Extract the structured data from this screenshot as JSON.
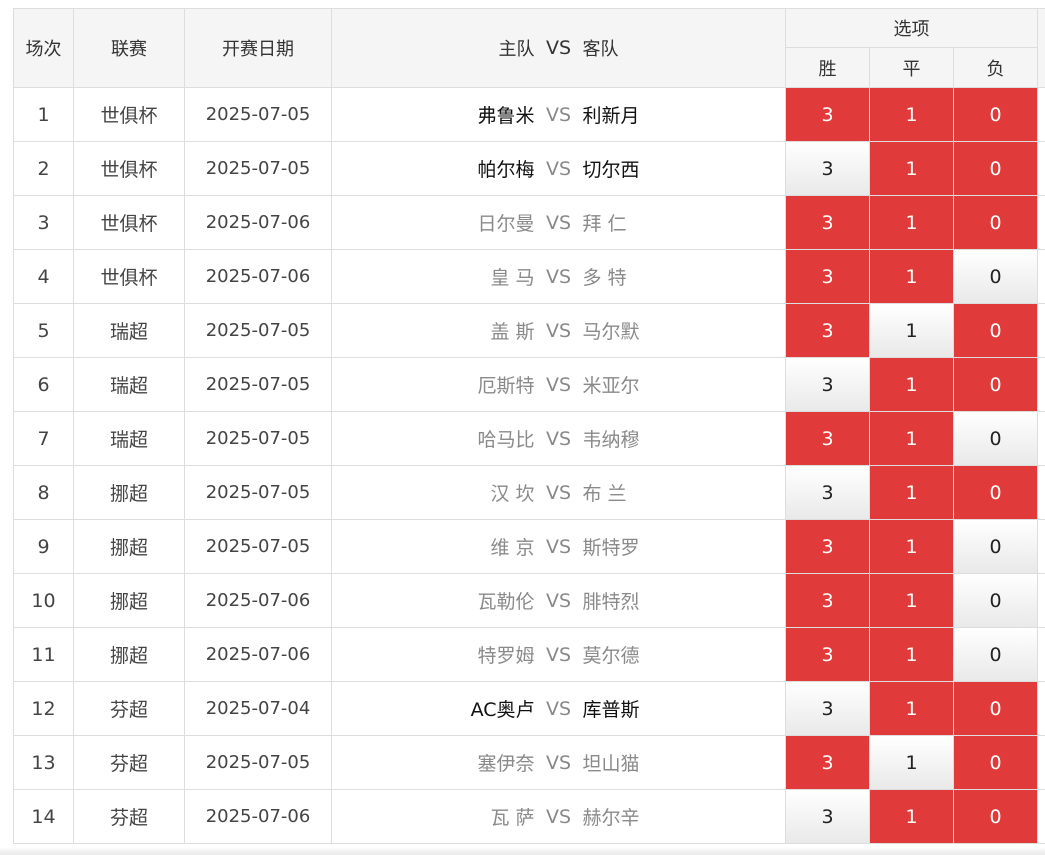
{
  "header": {
    "col_round": "场次",
    "col_league": "联赛",
    "col_date": "开赛日期",
    "col_home": "主队",
    "col_vs": "VS",
    "col_away": "客队",
    "col_options": "选项",
    "opt_win": "胜",
    "opt_draw": "平",
    "opt_loss": "负"
  },
  "colors": {
    "selected": "#e03a3a",
    "header_bg": "#f5f5f5",
    "border": "#dddddd"
  },
  "matches": [
    {
      "round": "1",
      "league": "世俱杯",
      "date": "2025-07-05",
      "home": "弗鲁米",
      "vs": "VS",
      "away": "利新月",
      "dark": true,
      "win": "3",
      "draw": "1",
      "loss": "0",
      "sel": [
        true,
        true,
        true
      ]
    },
    {
      "round": "2",
      "league": "世俱杯",
      "date": "2025-07-05",
      "home": "帕尔梅",
      "vs": "VS",
      "away": "切尔西",
      "dark": true,
      "win": "3",
      "draw": "1",
      "loss": "0",
      "sel": [
        false,
        true,
        true
      ]
    },
    {
      "round": "3",
      "league": "世俱杯",
      "date": "2025-07-06",
      "home": "日尔曼",
      "vs": "VS",
      "away": "拜 仁",
      "dark": false,
      "win": "3",
      "draw": "1",
      "loss": "0",
      "sel": [
        true,
        true,
        true
      ]
    },
    {
      "round": "4",
      "league": "世俱杯",
      "date": "2025-07-06",
      "home": "皇 马",
      "vs": "VS",
      "away": "多 特",
      "dark": false,
      "win": "3",
      "draw": "1",
      "loss": "0",
      "sel": [
        true,
        true,
        false
      ]
    },
    {
      "round": "5",
      "league": "瑞超",
      "date": "2025-07-05",
      "home": "盖 斯",
      "vs": "VS",
      "away": "马尔默",
      "dark": false,
      "win": "3",
      "draw": "1",
      "loss": "0",
      "sel": [
        true,
        false,
        true
      ]
    },
    {
      "round": "6",
      "league": "瑞超",
      "date": "2025-07-05",
      "home": "厄斯特",
      "vs": "VS",
      "away": "米亚尔",
      "dark": false,
      "win": "3",
      "draw": "1",
      "loss": "0",
      "sel": [
        false,
        true,
        true
      ]
    },
    {
      "round": "7",
      "league": "瑞超",
      "date": "2025-07-05",
      "home": "哈马比",
      "vs": "VS",
      "away": "韦纳穆",
      "dark": false,
      "win": "3",
      "draw": "1",
      "loss": "0",
      "sel": [
        true,
        true,
        false
      ]
    },
    {
      "round": "8",
      "league": "挪超",
      "date": "2025-07-05",
      "home": "汉 坎",
      "vs": "VS",
      "away": "布 兰",
      "dark": false,
      "win": "3",
      "draw": "1",
      "loss": "0",
      "sel": [
        false,
        true,
        true
      ]
    },
    {
      "round": "9",
      "league": "挪超",
      "date": "2025-07-05",
      "home": "维 京",
      "vs": "VS",
      "away": "斯特罗",
      "dark": false,
      "win": "3",
      "draw": "1",
      "loss": "0",
      "sel": [
        true,
        true,
        false
      ]
    },
    {
      "round": "10",
      "league": "挪超",
      "date": "2025-07-06",
      "home": "瓦勒伦",
      "vs": "VS",
      "away": "腓特烈",
      "dark": false,
      "win": "3",
      "draw": "1",
      "loss": "0",
      "sel": [
        true,
        true,
        false
      ]
    },
    {
      "round": "11",
      "league": "挪超",
      "date": "2025-07-06",
      "home": "特罗姆",
      "vs": "VS",
      "away": "莫尔德",
      "dark": false,
      "win": "3",
      "draw": "1",
      "loss": "0",
      "sel": [
        true,
        true,
        false
      ]
    },
    {
      "round": "12",
      "league": "芬超",
      "date": "2025-07-04",
      "home": "AC奥卢",
      "vs": "VS",
      "away": "库普斯",
      "dark": true,
      "win": "3",
      "draw": "1",
      "loss": "0",
      "sel": [
        false,
        true,
        true
      ]
    },
    {
      "round": "13",
      "league": "芬超",
      "date": "2025-07-05",
      "home": "塞伊奈",
      "vs": "VS",
      "away": "坦山猫",
      "dark": false,
      "win": "3",
      "draw": "1",
      "loss": "0",
      "sel": [
        true,
        false,
        true
      ]
    },
    {
      "round": "14",
      "league": "芬超",
      "date": "2025-07-06",
      "home": "瓦 萨",
      "vs": "VS",
      "away": "赫尔辛",
      "dark": false,
      "win": "3",
      "draw": "1",
      "loss": "0",
      "sel": [
        false,
        true,
        true
      ]
    }
  ]
}
